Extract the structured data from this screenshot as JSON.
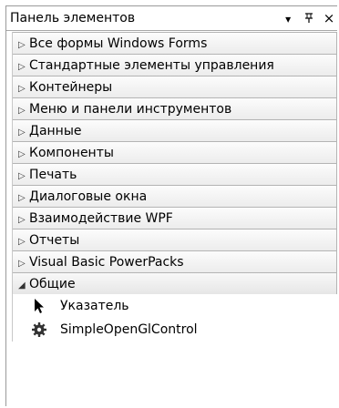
{
  "panel": {
    "title": "Панель элементов",
    "controls": {
      "dropdown": "▾",
      "pin": "ꟷ",
      "close": "×"
    }
  },
  "categories": [
    {
      "label": "Все формы Windows Forms",
      "arrow": "▷"
    },
    {
      "label": "Стандартные элементы управления",
      "arrow": "▷"
    },
    {
      "label": "Контейнеры",
      "arrow": "▷"
    },
    {
      "label": "Меню и панели инструментов",
      "arrow": "▷"
    },
    {
      "label": "Данные",
      "arrow": "▷"
    },
    {
      "label": "Компоненты",
      "arrow": "▷"
    },
    {
      "label": "Печать",
      "arrow": "▷"
    },
    {
      "label": "Диалоговые окна",
      "arrow": "▷"
    },
    {
      "label": "Взаимодействие WPF",
      "arrow": "▷"
    },
    {
      "label": "Отчеты",
      "arrow": "▷"
    },
    {
      "label": "Visual Basic PowerPacks",
      "arrow": "▷"
    },
    {
      "label": "Общие",
      "arrow": "◢",
      "expanded": true
    }
  ],
  "tools": [
    {
      "label": "Указатель",
      "icon": "pointer-arrow-icon"
    },
    {
      "label": "SimpleOpenGlControl",
      "icon": "gear-icon"
    }
  ]
}
